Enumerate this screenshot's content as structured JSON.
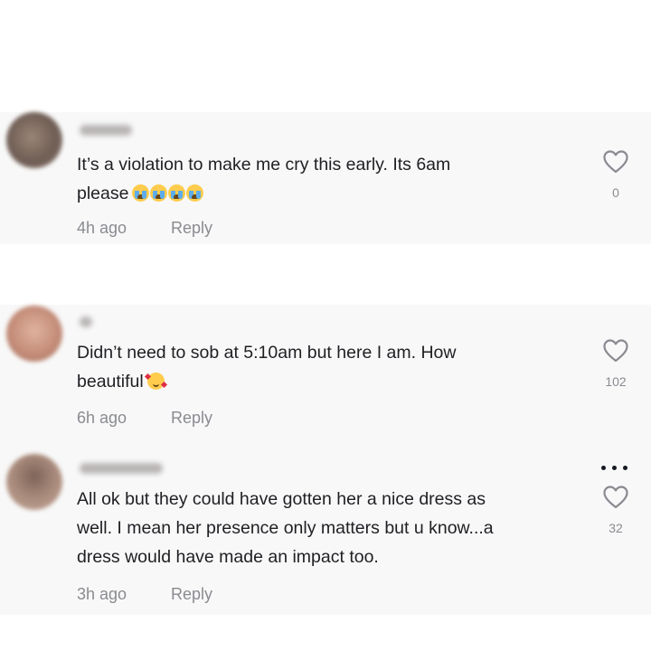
{
  "comments": [
    {
      "text_lines": [
        "It’s a violation to make me cry this early. Its 6am",
        "please"
      ],
      "emoji": "loudly-crying-face-emoji",
      "time": "4h ago",
      "reply": "Reply",
      "likes": "0"
    },
    {
      "text_lines": [
        "Didn’t need to sob at 5:10am but here I am. How",
        "beautiful"
      ],
      "emoji": "smiling-face-with-hearts-emoji",
      "time": "6h ago",
      "reply": "Reply",
      "likes": "102"
    },
    {
      "text_lines": [
        "All ok but they could have gotten her a nice dress as",
        "well. I mean her presence only matters but u know...a",
        "dress would have made an impact too."
      ],
      "time": "3h ago",
      "reply": "Reply",
      "likes": "32"
    }
  ],
  "icons": {
    "like": "heart-outline-icon",
    "more": "more-options-icon"
  },
  "colors": {
    "text": "#161823",
    "secondary": "#8a8b91",
    "panel": "#f8f8f8"
  }
}
